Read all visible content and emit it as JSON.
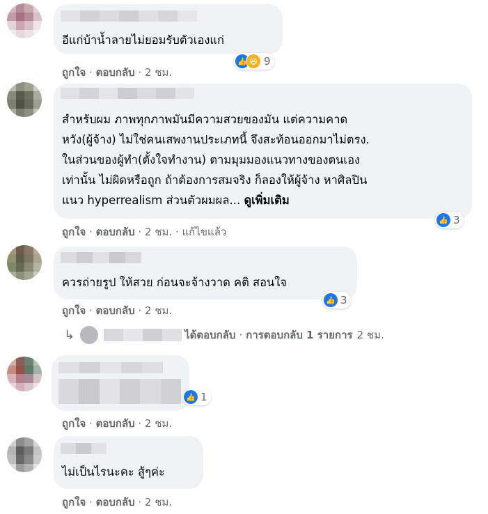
{
  "comments": [
    {
      "text_lines": [
        "อีแก่บ้าน้ำลายไม่ยอมรับตัวเองแก่"
      ],
      "actions": {
        "like": "ถูกใจ",
        "reply": "ตอบกลับ",
        "time": "2 ชม."
      },
      "reactions": {
        "icons": [
          "like-icon",
          "haha-icon"
        ],
        "count": "9"
      }
    },
    {
      "text_lines": [
        "สำหรับผม ภาพทุกภาพมันมีความสวยของมัน แต่ความคาด",
        "หวัง(ผู้จ้าง) ไม่ใช่คนเสพงานประเภทนี้ จึงสะท้อนออกมาไม่ตรง.",
        "ในส่วนของผู้ทำ(ตั้งใจทำงาน) ตามมุมมองแนวทางของตนเอง",
        "เท่านั้น ไม่ผิดหรือถูก ถ้าต้องการสมจริง ก็ลองให้ผู้จ้าง หาศิลปิน",
        "แนว hyperrealism ส่วนตัวผมผล..."
      ],
      "see_more": "ดูเพิ่มเติม",
      "actions": {
        "like": "ถูกใจ",
        "reply": "ตอบกลับ",
        "time": "2 ชม.",
        "edited": "แก้ไขแล้ว"
      },
      "reactions": {
        "icons": [
          "like-icon"
        ],
        "count": "3"
      }
    },
    {
      "text_lines": [
        "ควรถ่ายรูป ให้สวย ก่อนจะจ้างวาด คติ สอนใจ"
      ],
      "actions": {
        "like": "ถูกใจ",
        "reply": "ตอบกลับ",
        "time": "2 ชม."
      },
      "reactions": {
        "icons": [
          "like-icon"
        ],
        "count": "3"
      },
      "reply_summary": {
        "replied": "ได้ตอบกลับ",
        "sep": "·",
        "count_text": "การตอบกลับ 1 รายการ",
        "time": "2 ชม."
      }
    },
    {
      "text_lines": [],
      "actions": {
        "like": "ถูกใจ",
        "reply": "ตอบกลับ",
        "time": "2 ชม."
      },
      "reactions": {
        "icons": [
          "like-icon"
        ],
        "count": "1"
      }
    },
    {
      "text_lines": [
        "ไม่เป็นไรนะคะ สู้ๆค่ะ"
      ],
      "actions": {
        "like": "ถูกใจ",
        "reply": "ตอบกลับ",
        "time": "2 ชม."
      }
    }
  ],
  "colors": {
    "bubble": "#f0f2f5",
    "meta_text": "#65676b",
    "like_blue": "#1877f2",
    "haha_yellow": "#f7b125"
  }
}
